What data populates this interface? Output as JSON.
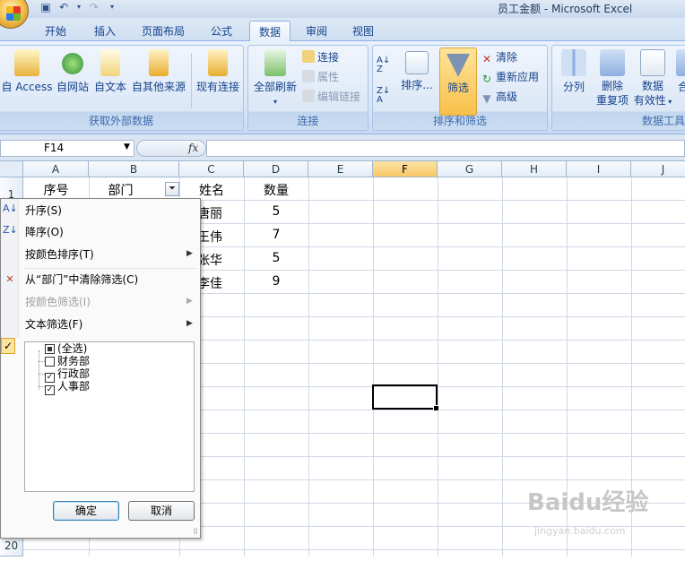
{
  "window": {
    "title": "员工金额 - Microsoft Excel"
  },
  "tabs": [
    "开始",
    "插入",
    "页面布局",
    "公式",
    "数据",
    "审阅",
    "视图"
  ],
  "active_tab": "数据",
  "ribbon": {
    "get_external": {
      "label": "获取外部数据",
      "btn_access": "自 Access",
      "btn_web": "自网站",
      "btn_text": "自文本",
      "btn_other": "自其他来源",
      "btn_existing": "现有连接"
    },
    "connections": {
      "label": "连接",
      "btn_refresh": "全部刷新",
      "btn_connections": "连接",
      "btn_properties": "属性",
      "btn_edit_links": "编辑链接"
    },
    "sort_filter": {
      "label": "排序和筛选",
      "btn_sort": "排序...",
      "btn_filter": "筛选",
      "btn_clear": "清除",
      "btn_reapply": "重新应用",
      "btn_advanced": "高级"
    },
    "data_tools": {
      "label": "数据工具",
      "btn_text_to_columns": "分列",
      "btn_remove_dup_1": "删除",
      "btn_remove_dup_2": "重复项",
      "btn_validation_1": "数据",
      "btn_validation_2": "有效性",
      "btn_more": "合"
    }
  },
  "formula_bar": {
    "name_box": "F14",
    "fx": "fx",
    "formula": ""
  },
  "sheet": {
    "columns": [
      "A",
      "B",
      "C",
      "D",
      "E",
      "F",
      "G",
      "H",
      "I",
      "J"
    ],
    "row_numbers": [
      "1",
      "20"
    ],
    "headers": {
      "a1": "序号",
      "b1": "部门",
      "c1": "姓名",
      "d1": "数量"
    },
    "names": [
      "唐丽",
      "王伟",
      "张华",
      "李佳"
    ],
    "quantities": [
      "5",
      "7",
      "5",
      "9"
    ]
  },
  "filter_menu": {
    "sort_asc": "升序(S)",
    "sort_desc": "降序(O)",
    "sort_by_color": "按颜色排序(T)",
    "clear_filter": "从“部门”中清除筛选(C)",
    "filter_by_color": "按颜色筛选(I)",
    "text_filters": "文本筛选(F)",
    "list": [
      {
        "label": "(全选)",
        "state": "partial"
      },
      {
        "label": "财务部",
        "state": "unchecked"
      },
      {
        "label": "行政部",
        "state": "checked"
      },
      {
        "label": "人事部",
        "state": "checked"
      }
    ],
    "ok": "确定",
    "cancel": "取消"
  },
  "watermark": {
    "main": "Baidu经验",
    "sub": "jingyan.baidu.com"
  },
  "colors": {
    "accent": "#15428b",
    "ribbon_bg": "#dbe7f6",
    "highlight": "#f9c04a"
  }
}
